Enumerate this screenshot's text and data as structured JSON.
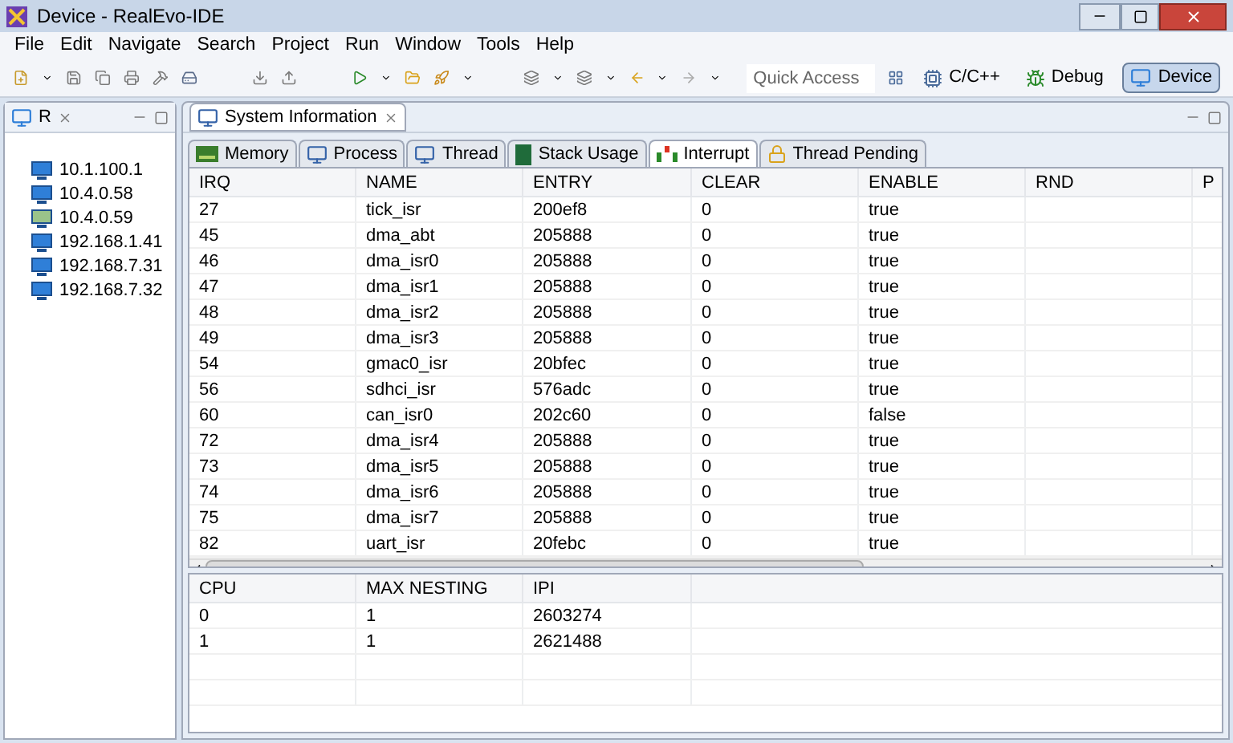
{
  "window": {
    "title": "Device - RealEvo-IDE"
  },
  "menu": [
    "File",
    "Edit",
    "Navigate",
    "Search",
    "Project",
    "Run",
    "Window",
    "Tools",
    "Help"
  ],
  "quick_access": {
    "placeholder": "Quick Access"
  },
  "perspectives": [
    {
      "label": "C/C++",
      "selected": false
    },
    {
      "label": "Debug",
      "selected": false
    },
    {
      "label": "Device",
      "selected": true
    }
  ],
  "left_view": {
    "title": "R",
    "hosts": [
      {
        "label": "10.1.100.1",
        "kind": "idle"
      },
      {
        "label": "10.4.0.58",
        "kind": "idle"
      },
      {
        "label": "10.4.0.59",
        "kind": "active"
      },
      {
        "label": "192.168.1.41",
        "kind": "idle"
      },
      {
        "label": "192.168.7.31",
        "kind": "idle"
      },
      {
        "label": "192.168.7.32",
        "kind": "idle"
      }
    ]
  },
  "main_view": {
    "title": "System Information",
    "tabs": [
      {
        "label": "Memory",
        "selected": false
      },
      {
        "label": "Process",
        "selected": false
      },
      {
        "label": "Thread",
        "selected": false
      },
      {
        "label": "Stack Usage",
        "selected": false
      },
      {
        "label": "Interrupt",
        "selected": true
      },
      {
        "label": "Thread Pending",
        "selected": false
      }
    ],
    "interrupt_table": {
      "columns": [
        "IRQ",
        "NAME",
        "ENTRY",
        "CLEAR",
        "ENABLE",
        "RND",
        "P"
      ],
      "rows": [
        [
          "27",
          "tick_isr",
          "200ef8",
          "0",
          "true"
        ],
        [
          "45",
          "dma_abt",
          "205888",
          "0",
          "true"
        ],
        [
          "46",
          "dma_isr0",
          "205888",
          "0",
          "true"
        ],
        [
          "47",
          "dma_isr1",
          "205888",
          "0",
          "true"
        ],
        [
          "48",
          "dma_isr2",
          "205888",
          "0",
          "true"
        ],
        [
          "49",
          "dma_isr3",
          "205888",
          "0",
          "true"
        ],
        [
          "54",
          "gmac0_isr",
          "20bfec",
          "0",
          "true"
        ],
        [
          "56",
          "sdhci_isr",
          "576adc",
          "0",
          "true"
        ],
        [
          "60",
          "can_isr0",
          "202c60",
          "0",
          "false"
        ],
        [
          "72",
          "dma_isr4",
          "205888",
          "0",
          "true"
        ],
        [
          "73",
          "dma_isr5",
          "205888",
          "0",
          "true"
        ],
        [
          "74",
          "dma_isr6",
          "205888",
          "0",
          "true"
        ],
        [
          "75",
          "dma_isr7",
          "205888",
          "0",
          "true"
        ],
        [
          "82",
          "uart_isr",
          "20febc",
          "0",
          "true"
        ]
      ]
    },
    "cpu_table": {
      "columns": [
        "CPU",
        "MAX NESTING",
        "IPI"
      ],
      "rows": [
        [
          "0",
          "1",
          "2603274"
        ],
        [
          "1",
          "1",
          "2621488"
        ]
      ]
    }
  }
}
